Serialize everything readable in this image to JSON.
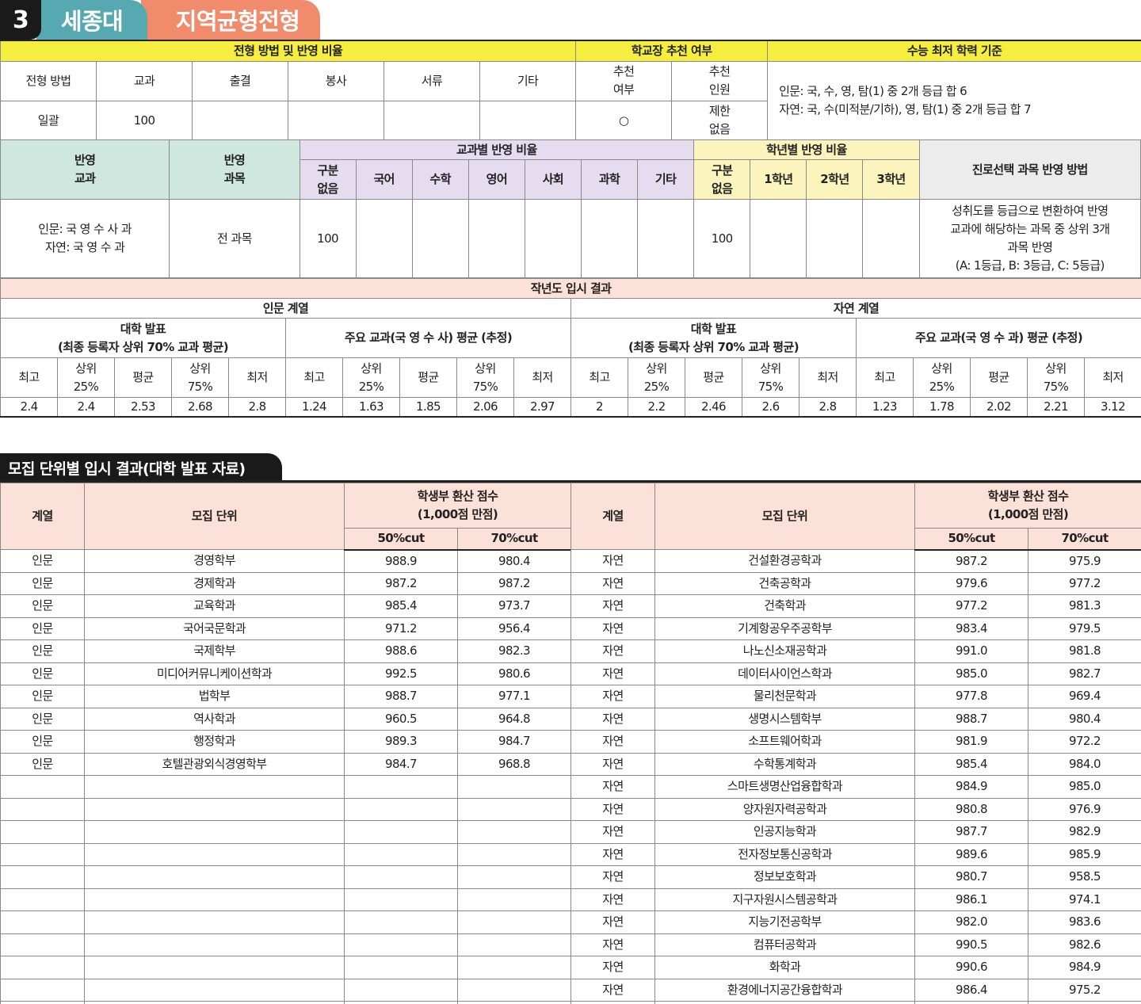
{
  "header": {
    "number": "3",
    "school": "세종대",
    "admission_type": "지역균형전형"
  },
  "method": {
    "group_headers": [
      "전형 방법 및 반영 비율",
      "학교장 추천 여부",
      "수능 최저 학력 기준"
    ],
    "col_labels": [
      "전형 방법",
      "교과",
      "출결",
      "봉사",
      "서류",
      "기타",
      "추천\n여부",
      "추천\n인원"
    ],
    "row": [
      "일괄",
      "100",
      "",
      "",
      "",
      "",
      "○",
      "제한\n없음"
    ],
    "csat_min": "인문: 국, 수, 영, 탐(1) 중 2개 등급 합 6\n자연: 국, 수(미적분/기하), 영, 탐(1) 중 2개 등급 합 7"
  },
  "subjects": {
    "h_subjects": "반영\n교과",
    "h_courses": "반영\n과목",
    "h_subject_ratio": "교과별 반영 비율",
    "subject_cols": [
      "구분\n없음",
      "국어",
      "수학",
      "영어",
      "사회",
      "과학",
      "기타"
    ],
    "h_grade_ratio": "학년별 반영 비율",
    "grade_cols": [
      "구분\n없음",
      "1학년",
      "2학년",
      "3학년"
    ],
    "h_career": "진로선택 과목 반영 방법",
    "val_subjects": "인문: 국 영 수 사 과\n자연: 국 영 수 과",
    "val_courses": "전 과목",
    "subject_vals": [
      "100",
      "",
      "",
      "",
      "",
      "",
      ""
    ],
    "grade_vals": [
      "100",
      "",
      "",
      ""
    ],
    "val_career": "성취도를 등급으로 변환하여 반영\n교과에 해당하는 과목 중 상위 3개\n과목 반영\n(A: 1등급, B: 3등급, C: 5등급)"
  },
  "last_year": {
    "title": "작년도 입시 결과",
    "tracks": [
      "인문 계열",
      "자연 계열"
    ],
    "sub_groups": [
      "대학 발표\n(최종 등록자 상위 70% 교과 평균)",
      "주요 교과(국 영 수 사) 평균 (추정)",
      "대학 발표\n(최종 등록자 상위 70% 교과 평균)",
      "주요 교과(국 영 수 과) 평균 (추정)"
    ],
    "stat_cols": [
      "최고",
      "상위\n25%",
      "평균",
      "상위\n75%",
      "최저"
    ],
    "values": [
      "2.4",
      "2.4",
      "2.53",
      "2.68",
      "2.8",
      "1.24",
      "1.63",
      "1.85",
      "2.06",
      "2.97",
      "2",
      "2.2",
      "2.46",
      "2.6",
      "2.8",
      "1.23",
      "1.78",
      "2.02",
      "2.21",
      "3.12"
    ]
  },
  "units": {
    "section_title": "모집 단위별 입시 결과(대학 발표 자료)",
    "h_track": "계열",
    "h_unit": "모집 단위",
    "h_score": "학생부 환산 점수\n(1,000점 만점)",
    "h_50": "50%cut",
    "h_70": "70%cut",
    "left_rows": [
      [
        "인문",
        "경영학부",
        "988.9",
        "980.4"
      ],
      [
        "인문",
        "경제학과",
        "987.2",
        "987.2"
      ],
      [
        "인문",
        "교육학과",
        "985.4",
        "973.7"
      ],
      [
        "인문",
        "국어국문학과",
        "971.2",
        "956.4"
      ],
      [
        "인문",
        "국제학부",
        "988.6",
        "982.3"
      ],
      [
        "인문",
        "미디어커뮤니케이션학과",
        "992.5",
        "980.6"
      ],
      [
        "인문",
        "법학부",
        "988.7",
        "977.1"
      ],
      [
        "인문",
        "역사학과",
        "960.5",
        "964.8"
      ],
      [
        "인문",
        "행정학과",
        "989.3",
        "984.7"
      ],
      [
        "인문",
        "호텔관광외식경영학부",
        "984.7",
        "968.8"
      ],
      [
        "",
        "",
        "",
        ""
      ],
      [
        "",
        "",
        "",
        ""
      ],
      [
        "",
        "",
        "",
        ""
      ],
      [
        "",
        "",
        "",
        ""
      ],
      [
        "",
        "",
        "",
        ""
      ],
      [
        "",
        "",
        "",
        ""
      ],
      [
        "",
        "",
        "",
        ""
      ],
      [
        "",
        "",
        "",
        ""
      ],
      [
        "",
        "",
        "",
        ""
      ],
      [
        "",
        "",
        "",
        ""
      ],
      [
        "",
        "",
        "",
        ""
      ]
    ],
    "right_rows": [
      [
        "자연",
        "건설환경공학과",
        "987.2",
        "975.9"
      ],
      [
        "자연",
        "건축공학과",
        "979.6",
        "977.2"
      ],
      [
        "자연",
        "건축학과",
        "977.2",
        "981.3"
      ],
      [
        "자연",
        "기계항공우주공학부",
        "983.4",
        "979.5"
      ],
      [
        "자연",
        "나노신소재공학과",
        "991.0",
        "981.8"
      ],
      [
        "자연",
        "데이터사이언스학과",
        "985.0",
        "982.7"
      ],
      [
        "자연",
        "물리천문학과",
        "977.8",
        "969.4"
      ],
      [
        "자연",
        "생명시스템학부",
        "988.7",
        "980.4"
      ],
      [
        "자연",
        "소프트웨어학과",
        "981.9",
        "972.2"
      ],
      [
        "자연",
        "수학통계학과",
        "985.4",
        "984.0"
      ],
      [
        "자연",
        "스마트생명산업융합학과",
        "984.9",
        "985.0"
      ],
      [
        "자연",
        "양자원자력공학과",
        "980.8",
        "976.9"
      ],
      [
        "자연",
        "인공지능학과",
        "987.7",
        "982.9"
      ],
      [
        "자연",
        "전자정보통신공학과",
        "989.6",
        "985.9"
      ],
      [
        "자연",
        "정보보호학과",
        "980.7",
        "958.5"
      ],
      [
        "자연",
        "지구자원시스템공학과",
        "986.1",
        "974.1"
      ],
      [
        "자연",
        "지능기전공학부",
        "982.0",
        "983.6"
      ],
      [
        "자연",
        "컴퓨터공학과",
        "990.5",
        "982.6"
      ],
      [
        "자연",
        "화학과",
        "990.6",
        "984.9"
      ],
      [
        "자연",
        "환경에너지공간융합학과",
        "986.4",
        "975.2"
      ],
      [
        "",
        "",
        "",
        ""
      ]
    ]
  }
}
